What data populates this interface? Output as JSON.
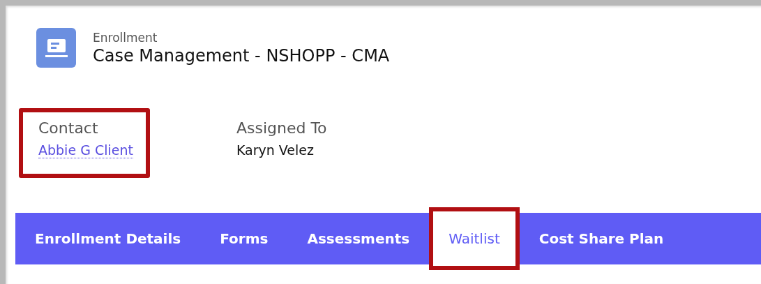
{
  "header": {
    "object_type": "Enrollment",
    "title": "Case Management - NSHOPP - CMA"
  },
  "fields": [
    {
      "label": "Contact",
      "value": "Abbie G Client",
      "kind": "link",
      "highlighted": true
    },
    {
      "label": "Assigned To",
      "value": "Karyn Velez",
      "kind": "text",
      "highlighted": false
    }
  ],
  "tabs": [
    {
      "label": "Enrollment Details",
      "selected": false,
      "highlighted": false
    },
    {
      "label": "Forms",
      "selected": false,
      "highlighted": false
    },
    {
      "label": "Assessments",
      "selected": false,
      "highlighted": false
    },
    {
      "label": "Waitlist",
      "selected": true,
      "highlighted": true
    },
    {
      "label": "Cost Share Plan",
      "selected": false,
      "highlighted": false
    }
  ]
}
